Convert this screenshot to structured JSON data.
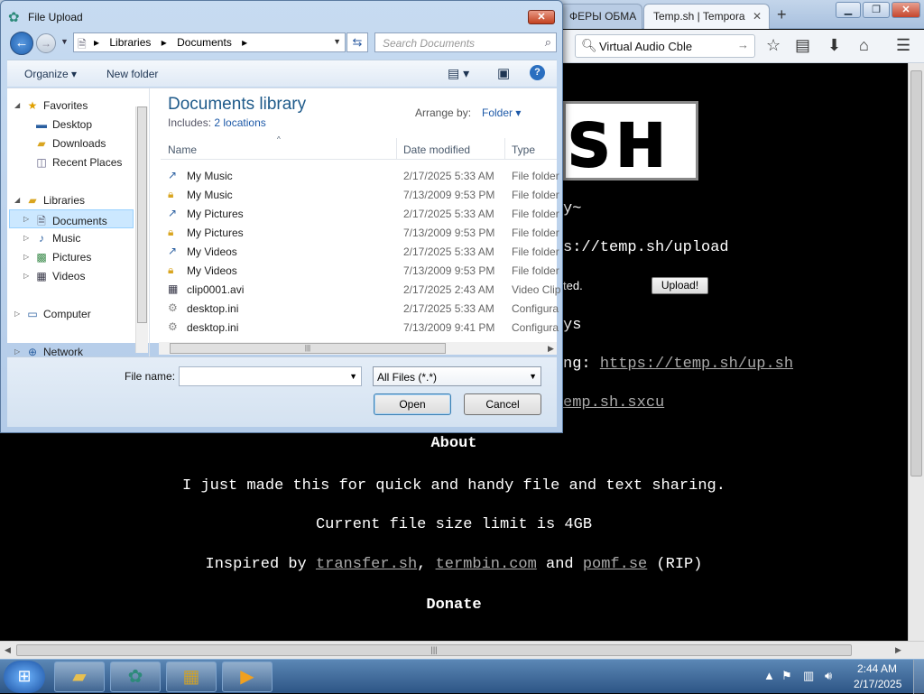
{
  "browser": {
    "tabs": [
      {
        "label": "ФЕРЫ ОБМА"
      },
      {
        "label": "Temp.sh | Tempora"
      }
    ],
    "new_tab_icon": "plus-icon",
    "window_controls": {
      "min": "▁",
      "max": "❐",
      "close": "✕"
    },
    "search_box": {
      "value": "Virtual Audio Cble"
    },
    "page": {
      "logo_text": "SH",
      "line_prompt": "y~",
      "line_upload_url": "s://temp.sh/upload",
      "selected_text": "ted.",
      "upload_button": "Upload!",
      "line_days": "ys",
      "line_script_prefix": "ng: ",
      "line_script_link": "https://temp.sh/up.sh",
      "line_sxcu": "emp.sh.sxcu",
      "about_heading": "About",
      "about_text": "I just made this for quick and handy file and text sharing.",
      "limit_text": "Current file size limit is 4GB",
      "inspired_prefix": "Inspired by ",
      "inspired_link1": "transfer.sh",
      "inspired_sep1": ", ",
      "inspired_link2": "termbin.com",
      "inspired_sep2": " and ",
      "inspired_link3": "pomf.se",
      "inspired_suffix": " (RIP)",
      "donate_heading": "Donate"
    }
  },
  "dialog": {
    "title": "File Upload",
    "close": "✕",
    "address": {
      "root_sep": "▸",
      "crumbs": [
        "Libraries",
        "Documents"
      ]
    },
    "search_placeholder": "Search Documents",
    "toolbar": {
      "organize": "Organize ▾",
      "new_folder": "New folder"
    },
    "nav": {
      "favorites": "Favorites",
      "desktop": "Desktop",
      "downloads": "Downloads",
      "recent": "Recent Places",
      "libraries": "Libraries",
      "documents": "Documents",
      "music": "Music",
      "pictures": "Pictures",
      "videos": "Videos",
      "computer": "Computer",
      "network": "Network"
    },
    "library": {
      "title": "Documents library",
      "includes_label": "Includes: ",
      "includes_link": "2 locations",
      "arrange_label": "Arrange by:",
      "arrange_value": "Folder ▾"
    },
    "columns": {
      "name": "Name",
      "date": "Date modified",
      "type": "Type"
    },
    "files": [
      {
        "icon": "shortcut-folder-icon",
        "name": "My Music",
        "date": "2/17/2025 5:33 AM",
        "type": "File folder"
      },
      {
        "icon": "locked-folder-icon",
        "name": "My Music",
        "date": "7/13/2009 9:53 PM",
        "type": "File folder"
      },
      {
        "icon": "shortcut-folder-icon",
        "name": "My Pictures",
        "date": "2/17/2025 5:33 AM",
        "type": "File folder"
      },
      {
        "icon": "locked-folder-icon",
        "name": "My Pictures",
        "date": "7/13/2009 9:53 PM",
        "type": "File folder"
      },
      {
        "icon": "shortcut-folder-icon",
        "name": "My Videos",
        "date": "2/17/2025 5:33 AM",
        "type": "File folder"
      },
      {
        "icon": "locked-folder-icon",
        "name": "My Videos",
        "date": "7/13/2009 9:53 PM",
        "type": "File folder"
      },
      {
        "icon": "video-file-icon",
        "name": "clip0001.avi",
        "date": "2/17/2025 2:43 AM",
        "type": "Video Clip"
      },
      {
        "icon": "config-file-icon",
        "name": "desktop.ini",
        "date": "2/17/2025 5:33 AM",
        "type": "Configura"
      },
      {
        "icon": "config-file-icon",
        "name": "desktop.ini",
        "date": "7/13/2009 9:41 PM",
        "type": "Configura"
      }
    ],
    "file_name_label": "File name:",
    "file_name_value": "",
    "filter": "All Files (*.*)",
    "open": "Open",
    "cancel": "Cancel"
  },
  "taskbar": {
    "time": "2:44 AM",
    "date": "2/17/2025"
  }
}
